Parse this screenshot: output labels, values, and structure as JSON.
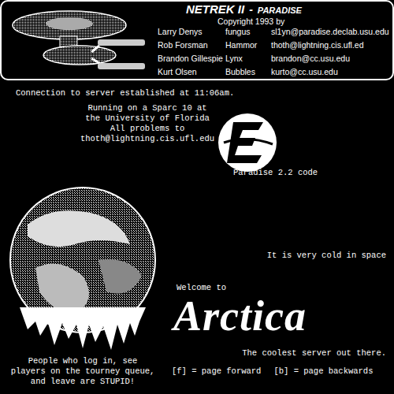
{
  "header": {
    "title": "NETREK II",
    "separator": "-",
    "subtitle": "PARADISE",
    "copyright": "Copyright 1993 by",
    "credits": [
      {
        "name": "Larry Denys",
        "handle": "fungus",
        "email": "sl1yn@paradise.declab.usu.edu"
      },
      {
        "name": "Rob Forsman",
        "handle": "Hammor",
        "email": "thoth@lightning.cis.ufl.ed"
      },
      {
        "name": "Brandon Gillespie",
        "handle": "Lynx",
        "email": "brandon@cc.usu.edu"
      },
      {
        "name": "Kurt Olsen",
        "handle": "Bubbles",
        "email": "kurto@cc.usu.edu"
      }
    ]
  },
  "connection": "Connection to server established at 11:06am.",
  "server_info": [
    "Running on a Sparc 10 at",
    "the University of Florida",
    "All problems to",
    "thoth@lightning.cis.ufl.edu"
  ],
  "logo": {
    "caption": "Paradise 2.2 code"
  },
  "tagline": "It is very cold in space",
  "welcome": "Welcome to",
  "server_name": "Arctica",
  "motto": "The coolest server out there.",
  "warning": [
    "People who log in, see",
    "players on the tourney queue,",
    "and leave are STUPID!"
  ],
  "nav": [
    "[f] = page forward",
    "[b] = page backwards"
  ]
}
